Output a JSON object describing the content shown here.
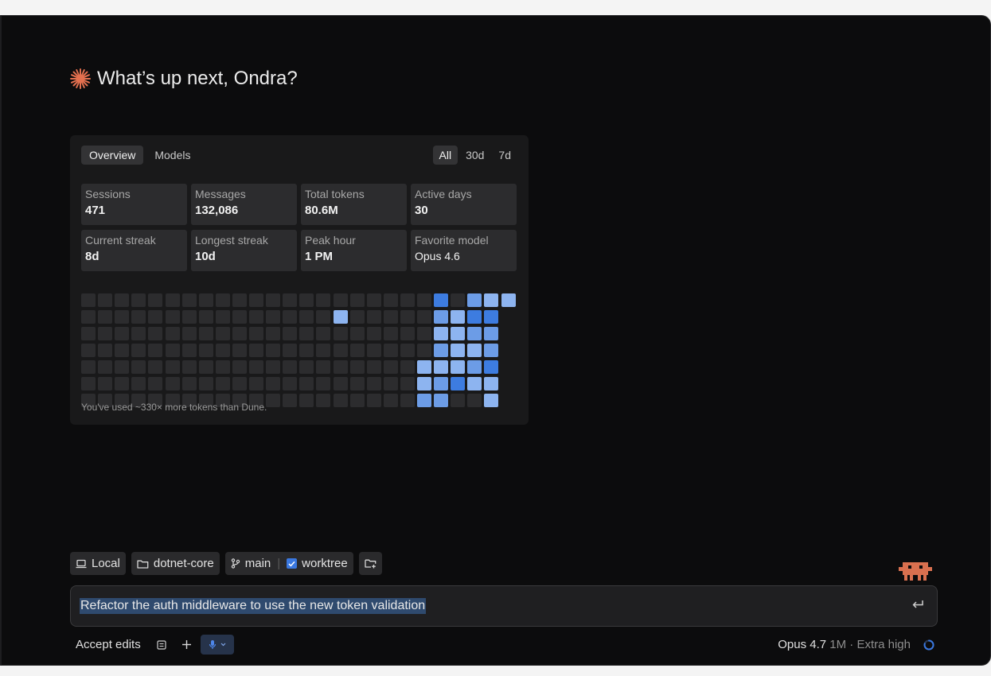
{
  "greeting": {
    "text": "What’s up next, Ondra?",
    "icon": "sparkle-icon",
    "icon_color": "#e3704f"
  },
  "stats": {
    "tabs": [
      {
        "label": "Overview",
        "active": true
      },
      {
        "label": "Models",
        "active": false
      }
    ],
    "ranges": [
      {
        "label": "All",
        "active": true
      },
      {
        "label": "30d",
        "active": false
      },
      {
        "label": "7d",
        "active": false
      }
    ],
    "metrics": [
      {
        "label": "Sessions",
        "value": "471"
      },
      {
        "label": "Messages",
        "value": "132,086"
      },
      {
        "label": "Total tokens",
        "value": "80.6M"
      },
      {
        "label": "Active days",
        "value": "30"
      },
      {
        "label": "Current streak",
        "value": "8d"
      },
      {
        "label": "Longest streak",
        "value": "10d"
      },
      {
        "label": "Peak hour",
        "value": "1 PM"
      },
      {
        "label": "Favorite model",
        "value": "Opus 4.6"
      }
    ],
    "heatmap": {
      "weeks": 26,
      "days": 7,
      "colors": {
        "empty": "#2c2c2e",
        "low": "#8db4f0",
        "mid": "#6c9ce6",
        "high": "#3d7ce0"
      },
      "active_cells": [
        [
          21,
          0,
          "high"
        ],
        [
          23,
          0,
          "mid"
        ],
        [
          24,
          0,
          "low"
        ],
        [
          25,
          0,
          "low"
        ],
        [
          15,
          1,
          "low"
        ],
        [
          21,
          1,
          "mid"
        ],
        [
          22,
          1,
          "low"
        ],
        [
          23,
          1,
          "high"
        ],
        [
          24,
          1,
          "high"
        ],
        [
          21,
          2,
          "low"
        ],
        [
          22,
          2,
          "low"
        ],
        [
          23,
          2,
          "mid"
        ],
        [
          24,
          2,
          "mid"
        ],
        [
          21,
          3,
          "mid"
        ],
        [
          22,
          3,
          "low"
        ],
        [
          23,
          3,
          "low"
        ],
        [
          24,
          3,
          "mid"
        ],
        [
          20,
          4,
          "low"
        ],
        [
          21,
          4,
          "low"
        ],
        [
          22,
          4,
          "low"
        ],
        [
          23,
          4,
          "mid"
        ],
        [
          24,
          4,
          "high"
        ],
        [
          20,
          5,
          "low"
        ],
        [
          21,
          5,
          "mid"
        ],
        [
          22,
          5,
          "high"
        ],
        [
          23,
          5,
          "low"
        ],
        [
          24,
          5,
          "low"
        ],
        [
          20,
          6,
          "mid"
        ],
        [
          21,
          6,
          "mid"
        ],
        [
          24,
          6,
          "low"
        ]
      ],
      "hidden_cells": [
        [
          25,
          1
        ],
        [
          25,
          2
        ],
        [
          25,
          3
        ],
        [
          25,
          4
        ],
        [
          25,
          5
        ],
        [
          25,
          6
        ]
      ]
    },
    "footnote": "You've used ~330× more tokens than Dune."
  },
  "context": {
    "location": {
      "label": "Local",
      "icon": "laptop-icon"
    },
    "folder": {
      "label": "dotnet-core",
      "icon": "folder-icon"
    },
    "branch": {
      "label": "main",
      "icon": "git-branch-icon"
    },
    "worktree": {
      "label": "worktree",
      "checked": true
    },
    "new_folder_icon": "folder-plus-icon"
  },
  "prompt": {
    "text": "Refactor the auth middleware to use the new token validation",
    "enter_icon": "return-icon"
  },
  "bottom": {
    "accept_label": "Accept edits",
    "model_name": "Opus 4.7",
    "model_context": "1M",
    "model_effort": "· Extra high"
  },
  "colors": {
    "accent": "#3a78e0",
    "mascot": "#d9704f"
  }
}
